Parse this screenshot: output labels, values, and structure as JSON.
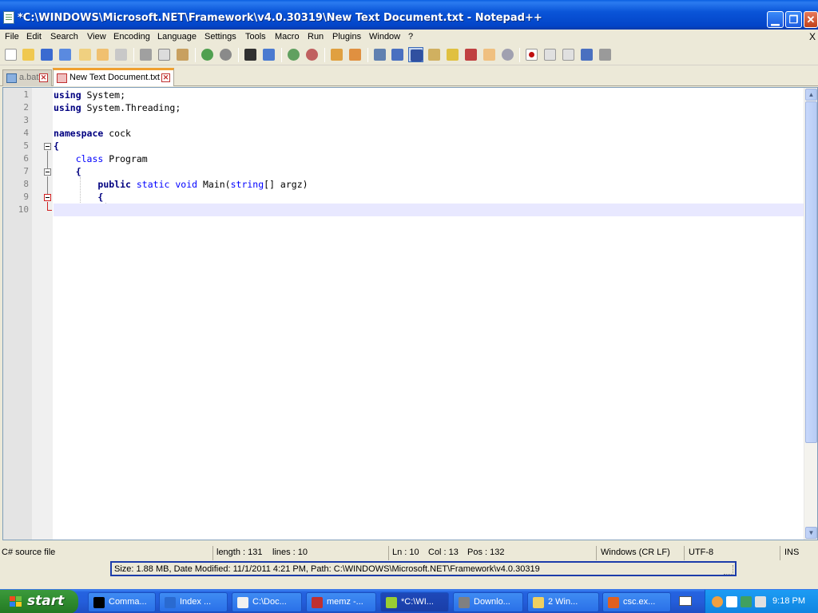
{
  "window": {
    "title": "*C:\\WINDOWS\\Microsoft.NET\\Framework\\v4.0.30319\\New Text Document.txt - Notepad++",
    "minimize": "_",
    "maximize": "□",
    "close": "✕"
  },
  "menu": {
    "items": [
      "File",
      "Edit",
      "Search",
      "View",
      "Encoding",
      "Language",
      "Settings",
      "Tools",
      "Macro",
      "Run",
      "Plugins",
      "Window",
      "?"
    ],
    "close_doc": "X"
  },
  "tabs": [
    {
      "label": "a.bat",
      "active": false
    },
    {
      "label": "New Text Document.txt",
      "active": true
    }
  ],
  "editor": {
    "line_numbers": [
      "1",
      "2",
      "3",
      "4",
      "5",
      "6",
      "7",
      "8",
      "9",
      "10"
    ],
    "lines": [
      [
        {
          "t": "using",
          "c": "kwb"
        },
        {
          "t": " System;",
          "c": ""
        }
      ],
      [
        {
          "t": "using",
          "c": "kwb"
        },
        {
          "t": " System.Threading;",
          "c": ""
        }
      ],
      [],
      [
        {
          "t": "namespace",
          "c": "kwb"
        },
        {
          "t": " cock",
          "c": ""
        }
      ],
      [
        {
          "t": "{",
          "c": "kwb"
        }
      ],
      [
        {
          "t": "    ",
          "c": ""
        },
        {
          "t": "class",
          "c": "kw"
        },
        {
          "t": " Program",
          "c": ""
        }
      ],
      [
        {
          "t": "    ",
          "c": ""
        },
        {
          "t": "{",
          "c": "kwb"
        }
      ],
      [
        {
          "t": "        ",
          "c": ""
        },
        {
          "t": "public",
          "c": "kwb"
        },
        {
          "t": " ",
          "c": ""
        },
        {
          "t": "static",
          "c": "kw"
        },
        {
          "t": " ",
          "c": ""
        },
        {
          "t": "void",
          "c": "kw"
        },
        {
          "t": " Main(",
          "c": ""
        },
        {
          "t": "string",
          "c": "kw"
        },
        {
          "t": "[] argz)",
          "c": ""
        }
      ],
      [
        {
          "t": "        ",
          "c": ""
        },
        {
          "t": "{",
          "c": "kwb"
        }
      ],
      []
    ],
    "current_line": 10
  },
  "status": {
    "file_type": "C# source file",
    "length": "length : 131",
    "lines": "lines : 10",
    "ln": "Ln : 10",
    "col": "Col : 13",
    "pos": "Pos : 132",
    "eol": "Windows (CR LF)",
    "encoding": "UTF-8",
    "mode": "INS"
  },
  "tooltip": {
    "text": "Size: 1.88 MB, Date Modified: 11/1/2011 4:21 PM, Path: C:\\WINDOWS\\Microsoft.NET\\Framework\\v4.0.30319"
  },
  "taskbar": {
    "start": "start",
    "tasks": [
      {
        "label": "Comma...",
        "icon_color": "#000000",
        "active": false
      },
      {
        "label": "Index ...",
        "icon_color": "#2a6ad0",
        "active": false
      },
      {
        "label": "C:\\Doc...",
        "icon_color": "#f0f0f0",
        "active": false
      },
      {
        "label": "memz -...",
        "icon_color": "#c03030",
        "active": false
      },
      {
        "label": "*C:\\WI...",
        "icon_color": "#9acd32",
        "active": true
      },
      {
        "label": "Downlo...",
        "icon_color": "#808080",
        "active": false
      },
      {
        "label": "2 Win...",
        "icon_color": "#f0d060",
        "active": false
      },
      {
        "label": "csc.ex...",
        "icon_color": "#e06020",
        "active": false
      }
    ],
    "clock": "9:18 PM"
  }
}
